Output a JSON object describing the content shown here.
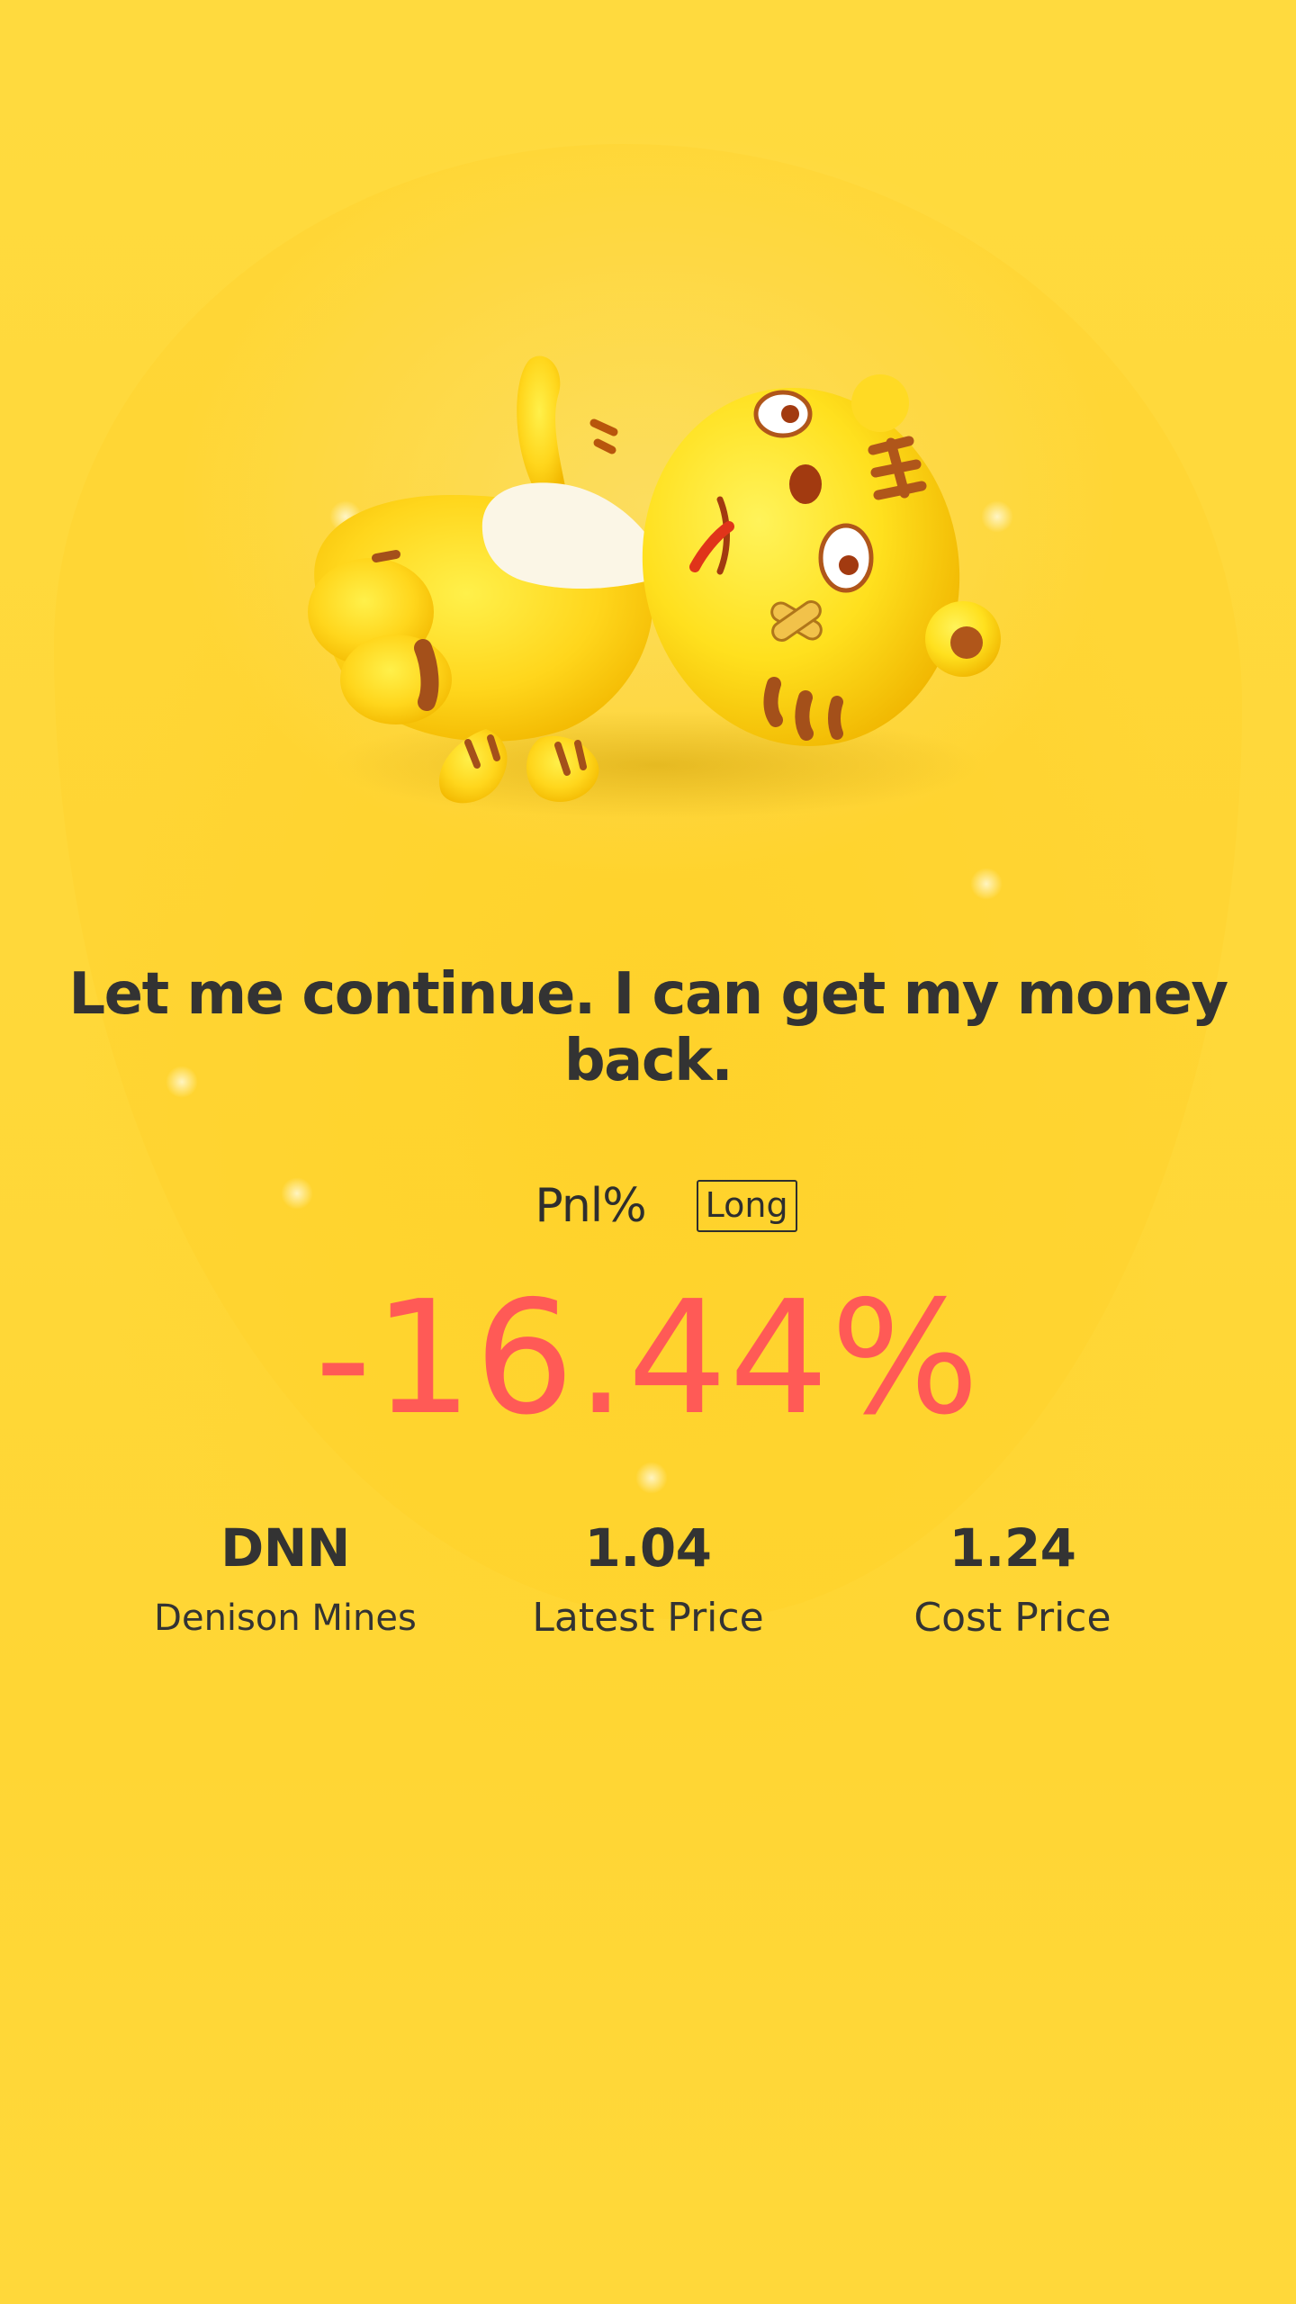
{
  "headline": "Let me continue. I can get my money back.",
  "pnl": {
    "label": "Pnl%",
    "position_badge": "Long",
    "value": "-16.44%",
    "value_color": "#FF5A56"
  },
  "stats": {
    "symbol": "DNN",
    "name": "Denison Mines",
    "latest_price": "1.04",
    "latest_price_label": "Latest Price",
    "cost_price": "1.24",
    "cost_price_label": "Cost Price"
  },
  "theme": {
    "background": "#FFD93A",
    "text": "#333333"
  },
  "mascot_icon": "tiger-mascot-lying-down"
}
